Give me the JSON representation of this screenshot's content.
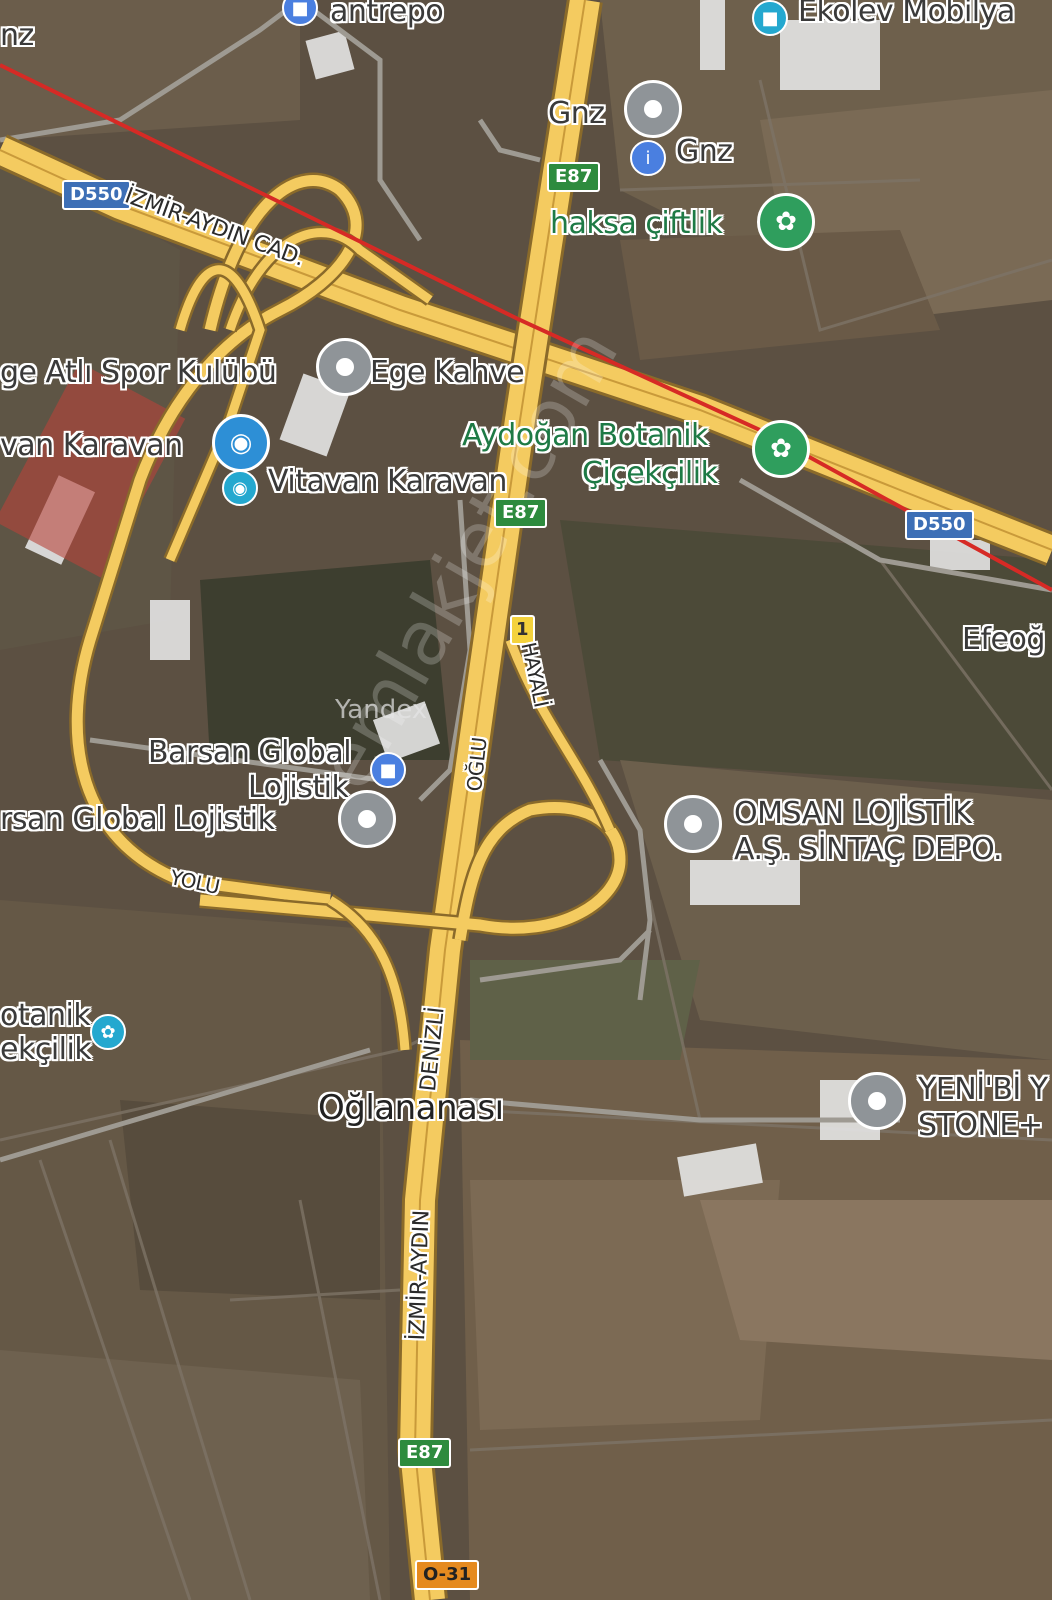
{
  "colors": {
    "road": "#f4cb60",
    "road_edge": "#8a6a2a",
    "rail": "#d62a25",
    "poi_gray": "#8f9498",
    "poi_green": "#2f9e5d",
    "poi_blue": "#2d8fd6",
    "shield_e": "#2e8b3e",
    "shield_d": "#3d6fb6"
  },
  "top_labels": {
    "antrepo": "antrepo",
    "ekolev": "Ekolev Mobilya",
    "nz": "nz",
    "gnz1": "Gnz",
    "gnz2": "Gnz",
    "haksa": "haksa çiftlik"
  },
  "mid_labels": {
    "ege_atli": "ge Atlı Spor Kulübü",
    "ege_kahve": "Ege Kahve",
    "karavan1": "van Karavan",
    "vitavan": "Vitavan Karavan",
    "aydogan1": "Aydoğan Botanik",
    "aydogan2": "Çiçekçilik",
    "efeog1": "Efeoğ",
    "barsan1": "Barsan Global",
    "barsan2": "Lojistik",
    "barsan3": "rsan Global Lojistik",
    "omsan1": "OMSAN LOJİSTİK",
    "omsan2": "A.Ş. SİNTAÇ DEPO.",
    "botanik1": "otanik",
    "botanik2": "ekçilik",
    "town": "Oğlananası",
    "yenibi1": "YENİ'Bİ Y",
    "yenibi2": "STONE+"
  },
  "road_labels": {
    "d550_a": "D550",
    "d550_b": "D550",
    "e87_a": "E87",
    "e87_b": "E87",
    "e87_c": "E87",
    "o31": "O-31",
    "one": "1",
    "izmir_aydin_cad": "İZMİR-AYDIN CAD.",
    "denizli": "DENİZLİ",
    "oglu": "OĞLU",
    "izmir_aydin": "İZMİR-AYDIN",
    "yolu": "YOLU",
    "hayali": "HAYALİ"
  },
  "watermark": "emlakjet.com",
  "yandex": "Yandex",
  "icons": [
    "pin-icon",
    "flower-icon",
    "bag-icon",
    "bed-icon",
    "box-icon",
    "tulip-icon"
  ]
}
